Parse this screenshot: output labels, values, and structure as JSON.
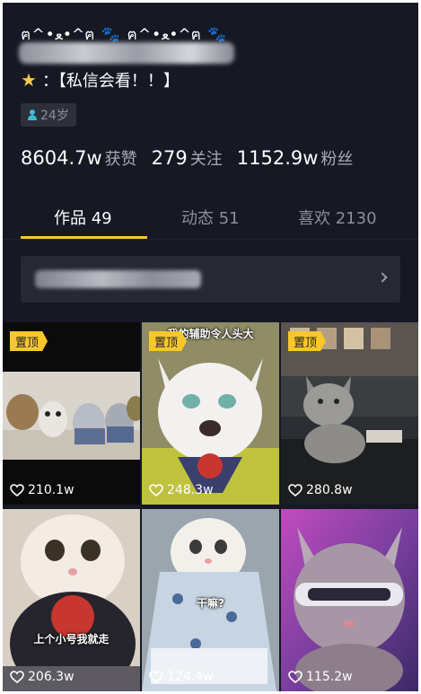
{
  "profile": {
    "emoji_line": "ฅ^•ﻌ•^ฅ 🐾 ฅ^•ﻌ•^ฅ 🐾",
    "bio_line": "：【私信会看！！】",
    "age": "24岁"
  },
  "stats": [
    {
      "value": "8604.7w",
      "label": "获赞"
    },
    {
      "value": "279",
      "label": "关注"
    },
    {
      "value": "1152.9w",
      "label": "粉丝"
    }
  ],
  "tabs": [
    {
      "label": "作品 49",
      "active": true
    },
    {
      "label": "动态 51",
      "active": false
    },
    {
      "label": "喜欢 2130",
      "active": false
    }
  ],
  "videos": [
    {
      "pinned": true,
      "pin_label": "置顶",
      "likes": "210.1w",
      "caption": "",
      "bg": "#0b0b0b"
    },
    {
      "pinned": true,
      "pin_label": "置顶",
      "likes": "248.3w",
      "caption": "我的辅助令人头大",
      "bg": "#6a6f3a"
    },
    {
      "pinned": true,
      "pin_label": "置顶",
      "likes": "280.8w",
      "caption": "",
      "bg": "#2e3337"
    },
    {
      "pinned": false,
      "pin_label": "",
      "likes": "206.3w",
      "caption": "上个小号我就走",
      "bg": "#d8d0c4"
    },
    {
      "pinned": false,
      "pin_label": "",
      "likes": "124.4w",
      "caption": "干嘛?",
      "bg": "#b8c7d6"
    },
    {
      "pinned": false,
      "pin_label": "",
      "likes": "115.2w",
      "caption": "",
      "bg": "#8b3fa8"
    }
  ],
  "colors": {
    "background": "#161824",
    "accent": "#f8c72a",
    "muted_text": "#a8aab3"
  },
  "icons": {
    "age": "person-icon",
    "like": "heart-outline-icon",
    "banner": "chevron-right-icon"
  }
}
